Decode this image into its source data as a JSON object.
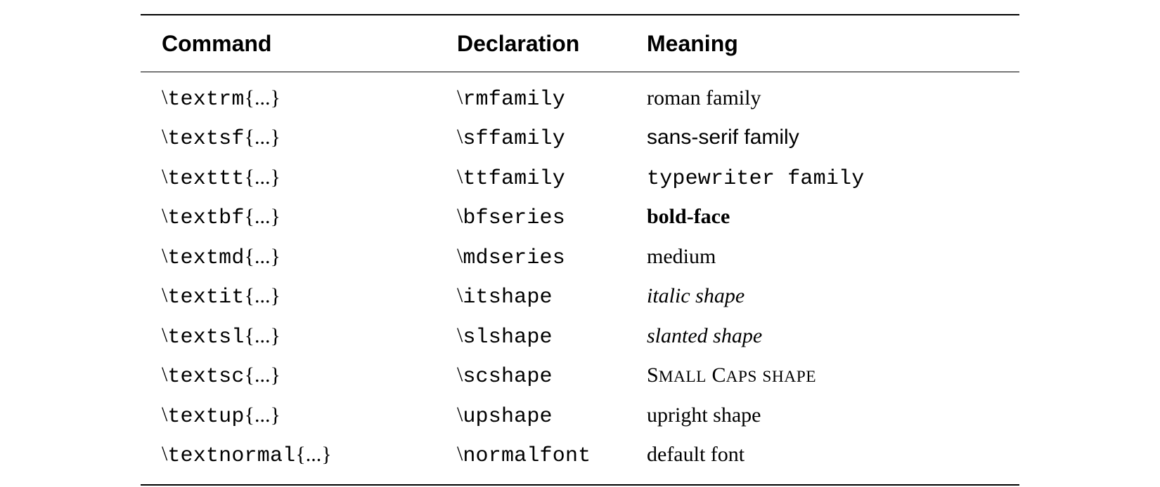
{
  "headers": {
    "command": "Command",
    "declaration": "Declaration",
    "meaning": "Meaning"
  },
  "rows": [
    {
      "command_tt": "textrm",
      "declaration_tt": "rmfamily",
      "meaning": "roman family",
      "style": "rm"
    },
    {
      "command_tt": "textsf",
      "declaration_tt": "sffamily",
      "meaning": "sans-serif family",
      "style": "sf"
    },
    {
      "command_tt": "texttt",
      "declaration_tt": "ttfamily",
      "meaning": "typewriter family",
      "style": "tt"
    },
    {
      "command_tt": "textbf",
      "declaration_tt": "bfseries",
      "meaning": "bold-face",
      "style": "bf"
    },
    {
      "command_tt": "textmd",
      "declaration_tt": "mdseries",
      "meaning": "medium",
      "style": "rm"
    },
    {
      "command_tt": "textit",
      "declaration_tt": "itshape",
      "meaning": "italic shape",
      "style": "it"
    },
    {
      "command_tt": "textsl",
      "declaration_tt": "slshape",
      "meaning": "slanted shape",
      "style": "sl"
    },
    {
      "command_tt": "textsc",
      "declaration_tt": "scshape",
      "meaning": "Small Caps shape",
      "style": "sc"
    },
    {
      "command_tt": "textup",
      "declaration_tt": "upshape",
      "meaning": "upright shape",
      "style": "rm"
    },
    {
      "command_tt": "textnormal",
      "declaration_tt": "normalfont",
      "meaning": "default font",
      "style": "rm"
    }
  ],
  "arg_suffix": "{...}",
  "backslash": "\\"
}
